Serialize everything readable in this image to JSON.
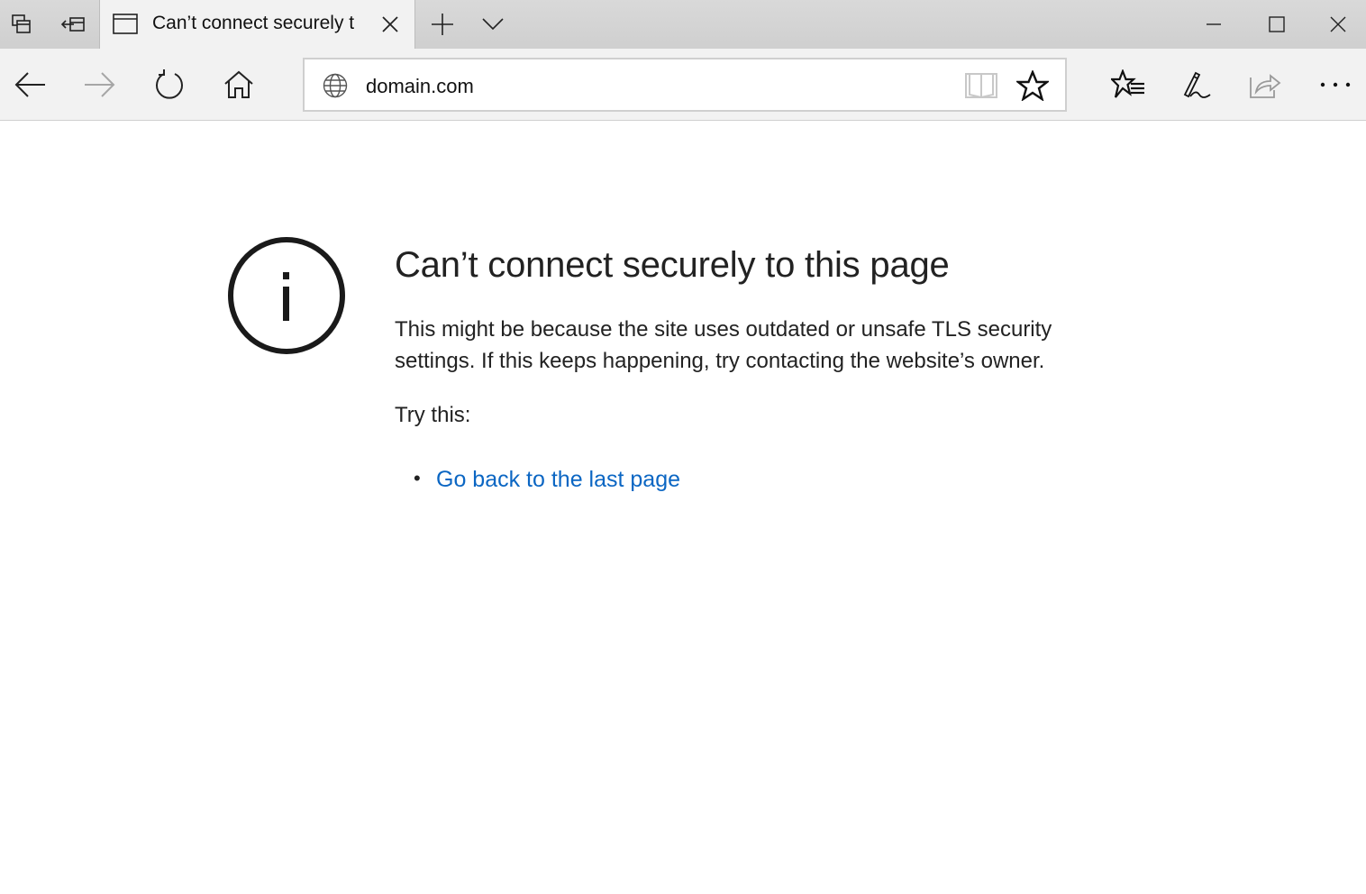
{
  "window": {
    "tab_title": "Can’t connect securely t",
    "controls": [
      "minimize",
      "maximize",
      "close"
    ]
  },
  "toolbar": {
    "address": "domain.com",
    "icons": [
      "back-icon",
      "forward-icon",
      "refresh-icon",
      "home-icon",
      "globe-icon",
      "reading-view-icon",
      "favorite-star-icon",
      "favorites-hub-icon",
      "web-note-icon",
      "share-icon",
      "more-icon"
    ]
  },
  "page": {
    "heading": "Can’t connect securely to this page",
    "description": "This might be because the site uses outdated or unsafe TLS security settings. If this keeps happening, try contacting the website’s owner.",
    "try_label": "Try this:",
    "suggestions": [
      {
        "label": "Go back to the last page"
      }
    ],
    "link_color": "#0b66c3"
  }
}
